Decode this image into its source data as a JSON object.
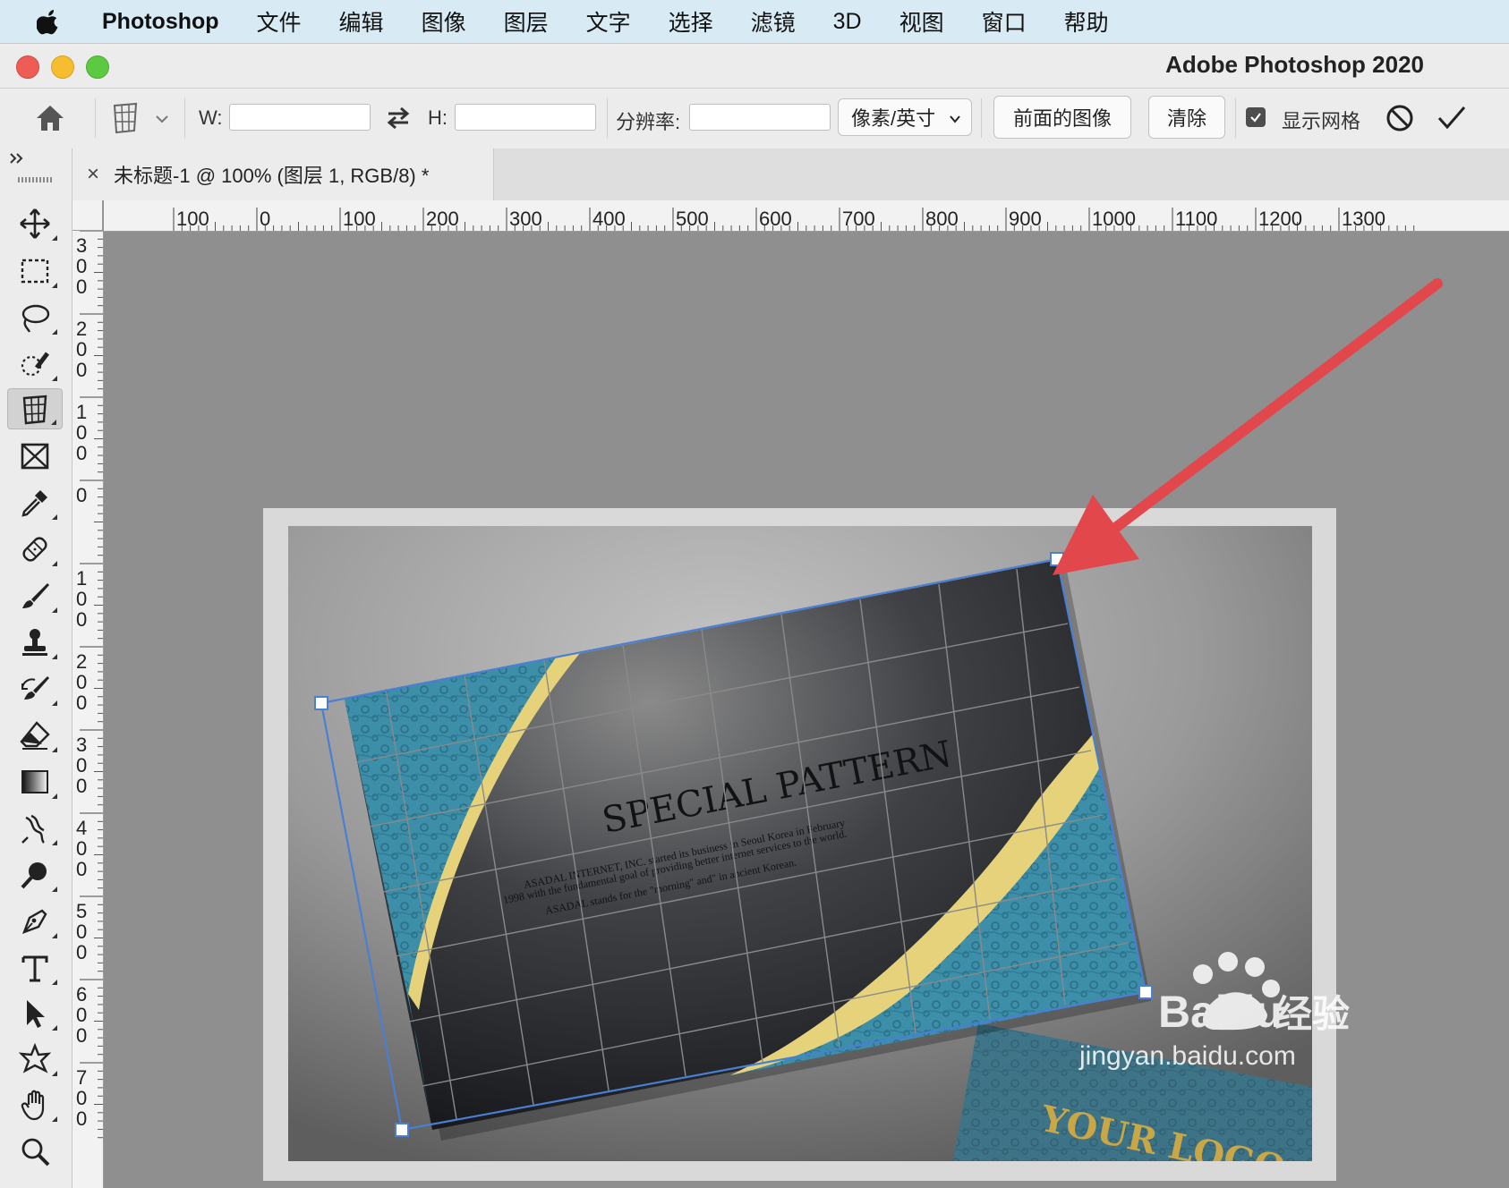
{
  "menubar": {
    "apple_icon": "apple-logo",
    "items": [
      "Photoshop",
      "文件",
      "编辑",
      "图像",
      "图层",
      "文字",
      "选择",
      "滤镜",
      "3D",
      "视图",
      "窗口",
      "帮助"
    ]
  },
  "window": {
    "title": "Adobe Photoshop 2020",
    "traffic_colors": [
      "#ee5d55",
      "#f5bd2f",
      "#5dc942"
    ]
  },
  "options_bar": {
    "w_label": "W:",
    "w_value": "",
    "h_label": "H:",
    "h_value": "",
    "resolution_label": "分辨率:",
    "resolution_value": "",
    "unit_select": "像素/英寸",
    "front_image_button": "前面的图像",
    "clear_button": "清除",
    "show_grid_label": "显示网格",
    "show_grid_checked": true
  },
  "document_tab": {
    "close_glyph": "×",
    "title": "未标题-1 @ 100% (图层 1, RGB/8) *"
  },
  "tools": [
    "move-tool",
    "rectangular-marquee-tool",
    "lasso-tool",
    "quick-selection-tool",
    "perspective-crop-tool",
    "frame-tool",
    "eyedropper-tool",
    "spot-healing-tool",
    "brush-tool",
    "clone-stamp-tool",
    "history-brush-tool",
    "eraser-tool",
    "gradient-tool",
    "blur-tool",
    "dodge-tool",
    "pen-tool",
    "type-tool",
    "path-selection-tool",
    "custom-shape-tool",
    "hand-tool",
    "zoom-tool"
  ],
  "ruler_h_labels": [
    "100",
    "0",
    "100",
    "200",
    "300",
    "400",
    "500",
    "600",
    "700",
    "800",
    "900",
    "1000",
    "1100",
    "1200",
    "1300"
  ],
  "ruler_v_labels": [
    "300",
    "200",
    "100",
    "0",
    "100",
    "200",
    "300",
    "400",
    "500",
    "600",
    "700"
  ],
  "card": {
    "title": "SPECIAL PATTERN",
    "body_lines": [
      "ASADAL INTERNET, INC. started its business in Seoul Korea in February",
      "1998 with the fundamental goal of providing better internet services to the world.",
      "ASADAL stands for the \"morning\" and\" in ancient Korean."
    ],
    "logo_text": "YOUR LOGO"
  },
  "watermark": {
    "brand": "Baidu",
    "brand_cn": "经验",
    "url": "jingyan.baidu.com"
  },
  "accent_colors": {
    "grid_line": "#4a7fd4",
    "arrow": "#e2474b",
    "gold": "#e6d27a",
    "teal": "#3d8ea8"
  }
}
